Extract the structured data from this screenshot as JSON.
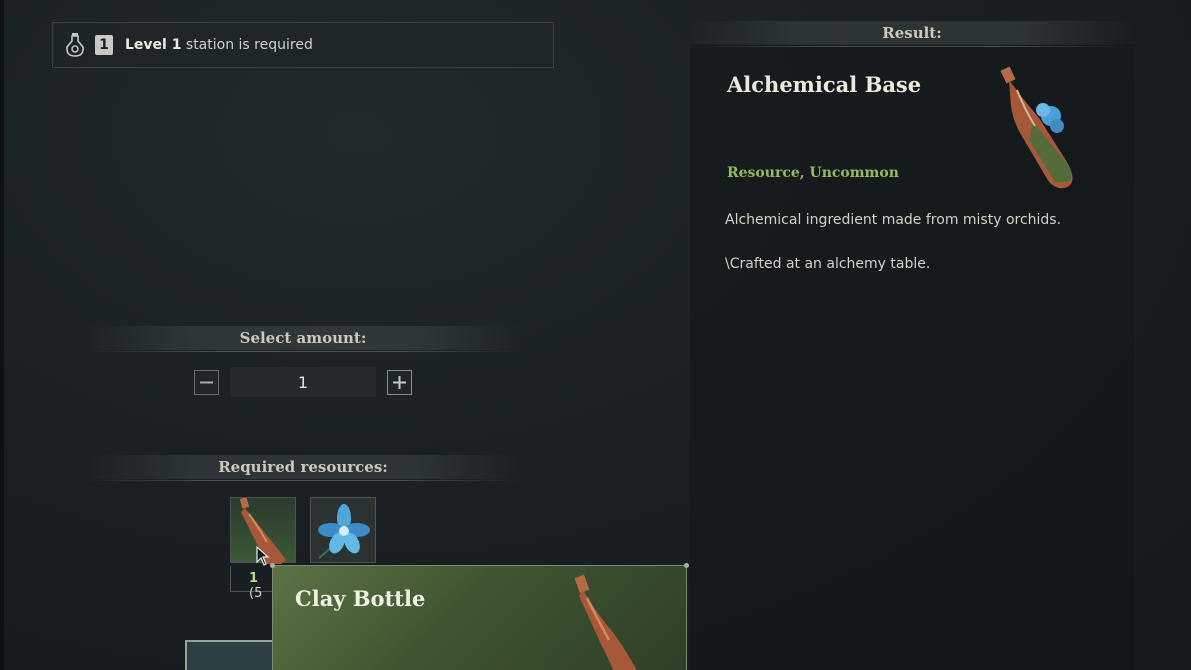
{
  "station": {
    "level_number": "1",
    "level_label": "Level 1",
    "suffix": " station is required",
    "icon": "flask-icon"
  },
  "amount": {
    "heading": "Select amount:",
    "value": "1",
    "decrease_icon": "minus-icon",
    "increase_icon": "plus-icon"
  },
  "resources": {
    "heading": "Required resources:",
    "items": [
      {
        "name": "clay-bottle",
        "count_have": "1",
        "count_rest": " (5"
      },
      {
        "name": "misty-orchid"
      }
    ]
  },
  "result": {
    "heading": "Result:",
    "title": "Alchemical Base",
    "subtitle": "Resource, Uncommon",
    "description": "Alchemical ingredient made from misty orchids.",
    "description2": "\\Crafted at an alchemy table."
  },
  "tooltip": {
    "title": "Clay Bottle"
  },
  "colors": {
    "accent_green": "#93bb64",
    "count_green": "#b7d98a",
    "tooltip_green": "#3f5532"
  }
}
